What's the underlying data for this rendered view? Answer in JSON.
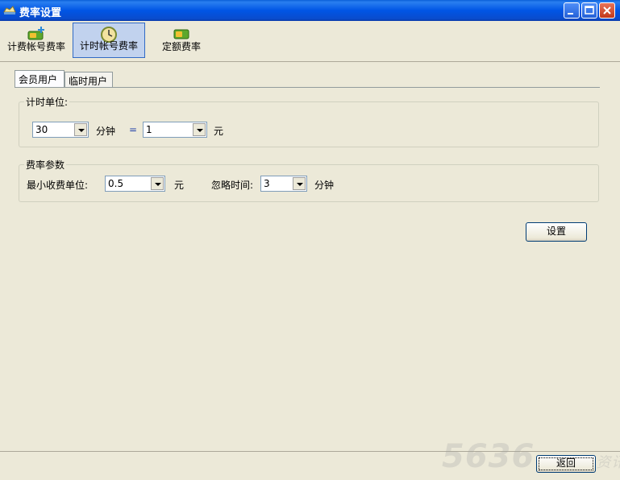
{
  "window": {
    "title": "费率设置"
  },
  "toolbar": {
    "items": [
      {
        "label": "计费帐号费率",
        "icon": "money-plus-icon"
      },
      {
        "label": "计时帐号费率",
        "icon": "clock-icon",
        "active": true
      },
      {
        "label": "定额费率",
        "icon": "money-icon"
      }
    ]
  },
  "tabs": [
    {
      "label": "会员用户",
      "active": true
    },
    {
      "label": "临时用户"
    }
  ],
  "timing_group": {
    "label": "计时单位:",
    "minutes_value": "30",
    "minutes_unit": "分钟",
    "equals": "=",
    "yuan_value": "1",
    "yuan_unit": "元"
  },
  "rate_group": {
    "label": "费率参数",
    "min_charge_label": "最小收费单位:",
    "min_charge_value": "0.5",
    "min_charge_unit": "元",
    "ignore_time_label": "忽略时间:",
    "ignore_time_value": "3",
    "ignore_time_unit": "分钟"
  },
  "buttons": {
    "set": "设置",
    "back": "返回"
  },
  "watermark": {
    "number": "5636",
    "text": "网吧门户资讯"
  },
  "colors": {
    "title_bar": "#0055e5",
    "face": "#ece9d8",
    "active_tool": "#c1d2ee"
  }
}
